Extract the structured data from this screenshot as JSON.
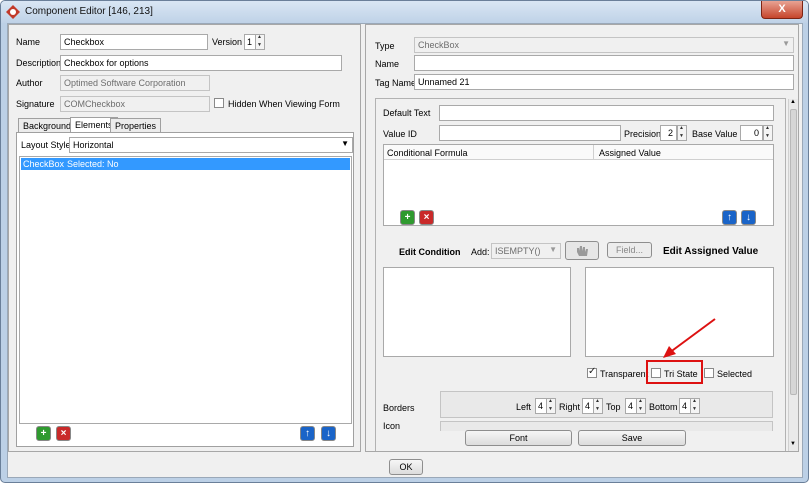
{
  "window": {
    "title": "Component Editor [146, 213]",
    "close_label": "X"
  },
  "left": {
    "name_label": "Name",
    "name_value": "Checkbox",
    "version_label": "Version",
    "version_value": "1",
    "description_label": "Description",
    "description_value": "Checkbox for options",
    "author_label": "Author",
    "author_value": "Optimed Software Corporation",
    "signature_label": "Signature",
    "signature_value": "COMCheckbox",
    "hidden_label": "Hidden When Viewing Form",
    "tabs": [
      "Background",
      "Elements",
      "Properties"
    ],
    "layout_style_label": "Layout Style",
    "layout_style_value": "Horizontal",
    "list_items": [
      {
        "name": "CheckBox",
        "detail": "Selected: No"
      }
    ]
  },
  "right": {
    "type_label": "Type",
    "type_value": "CheckBox",
    "name_label": "Name",
    "name_value": "",
    "tag_label": "Tag Name",
    "tag_value": "Unnamed 21",
    "default_text_label": "Default Text",
    "value_id_label": "Value ID",
    "precision_label": "Precision",
    "precision_value": "2",
    "base_value_label": "Base Value",
    "base_value_value": "0",
    "table_headers": [
      "Conditional Formula",
      "Assigned Value"
    ],
    "edit_condition_label": "Edit Condition",
    "add_label": "Add:",
    "add_select_value": "ISEMPTY()",
    "field_button": "Field...",
    "edit_assigned_label": "Edit Assigned Value",
    "transparent_label": "Transparent",
    "tristate_label": "Tri State",
    "selected_label": "Selected",
    "borders_label": "Borders",
    "left_label": "Left",
    "left_value": "4",
    "right_label": "Right",
    "right_value": "4",
    "top_label": "Top",
    "top_value": "4",
    "bottom_label": "Bottom",
    "bottom_value": "4",
    "icon_label": "Icon",
    "font_button": "Font",
    "save_button": "Save"
  },
  "footer": {
    "ok_button": "OK"
  },
  "colors": {
    "selection": "#3399ff",
    "annotation": "#dd1111"
  }
}
